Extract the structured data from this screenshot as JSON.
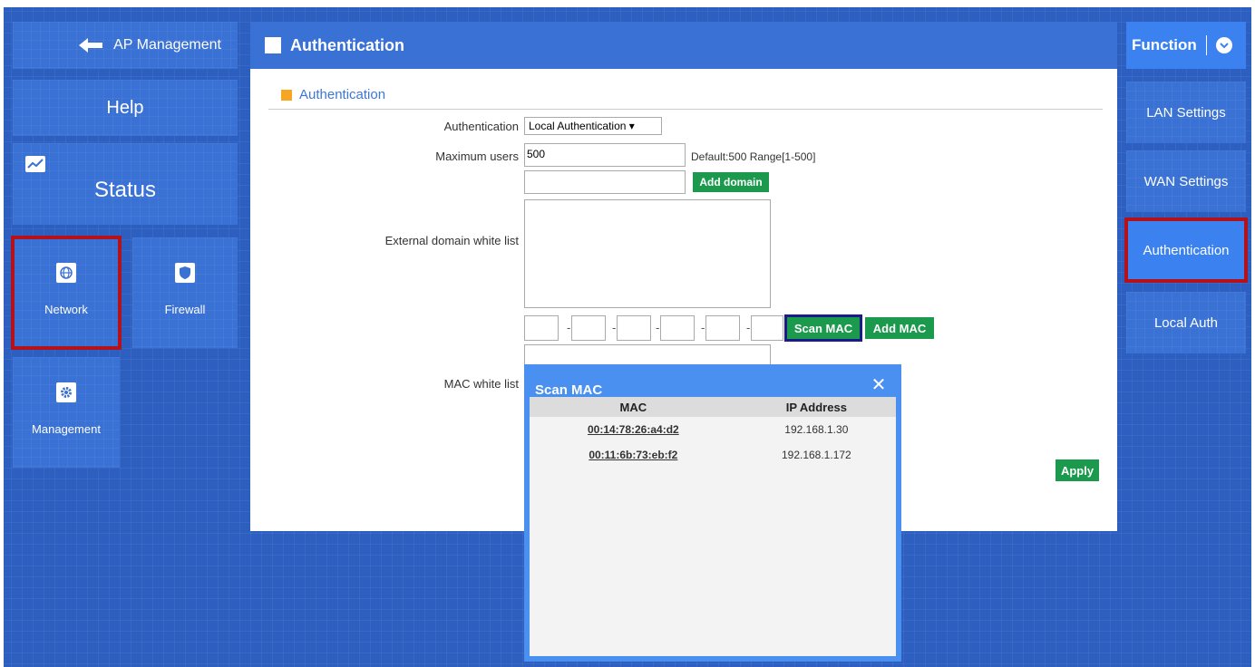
{
  "left_nav": {
    "ap_management": "AP Management",
    "help": "Help",
    "status": "Status",
    "network": "Network",
    "firewall": "Firewall",
    "management": "Management"
  },
  "header": {
    "title": "Authentication"
  },
  "form": {
    "section_title": "Authentication",
    "authentication_label": "Authentication",
    "authentication_value": "Local Authentication ▾",
    "max_users_label": "Maximum users",
    "max_users_value": "500",
    "max_users_hint": "Default:500 Range[1-500]",
    "add_domain": "Add domain",
    "domain_whitelist_label": "External domain white list",
    "scan_mac": "Scan MAC",
    "add_mac": "Add MAC",
    "mac_whitelist_label": "MAC white list",
    "apply": "Apply"
  },
  "right_nav": {
    "function": "Function",
    "lan_settings": "LAN Settings",
    "wan_settings": "WAN Settings",
    "authentication": "Authentication",
    "local_auth": "Local Auth"
  },
  "scan_modal": {
    "title": "Scan MAC",
    "col_mac": "MAC",
    "col_ip": "IP Address",
    "rows": [
      {
        "mac": "00:14:78:26:a4:d2",
        "ip": "192.168.1.30"
      },
      {
        "mac": "00:11:6b:73:eb:f2",
        "ip": "192.168.1.172"
      }
    ]
  },
  "colors": {
    "background": "#2c5fc0",
    "tile": "#3a71d4",
    "green_button": "#1b9a4e",
    "highlight_red": "#b3121b",
    "accent_orange": "#f5a623"
  }
}
